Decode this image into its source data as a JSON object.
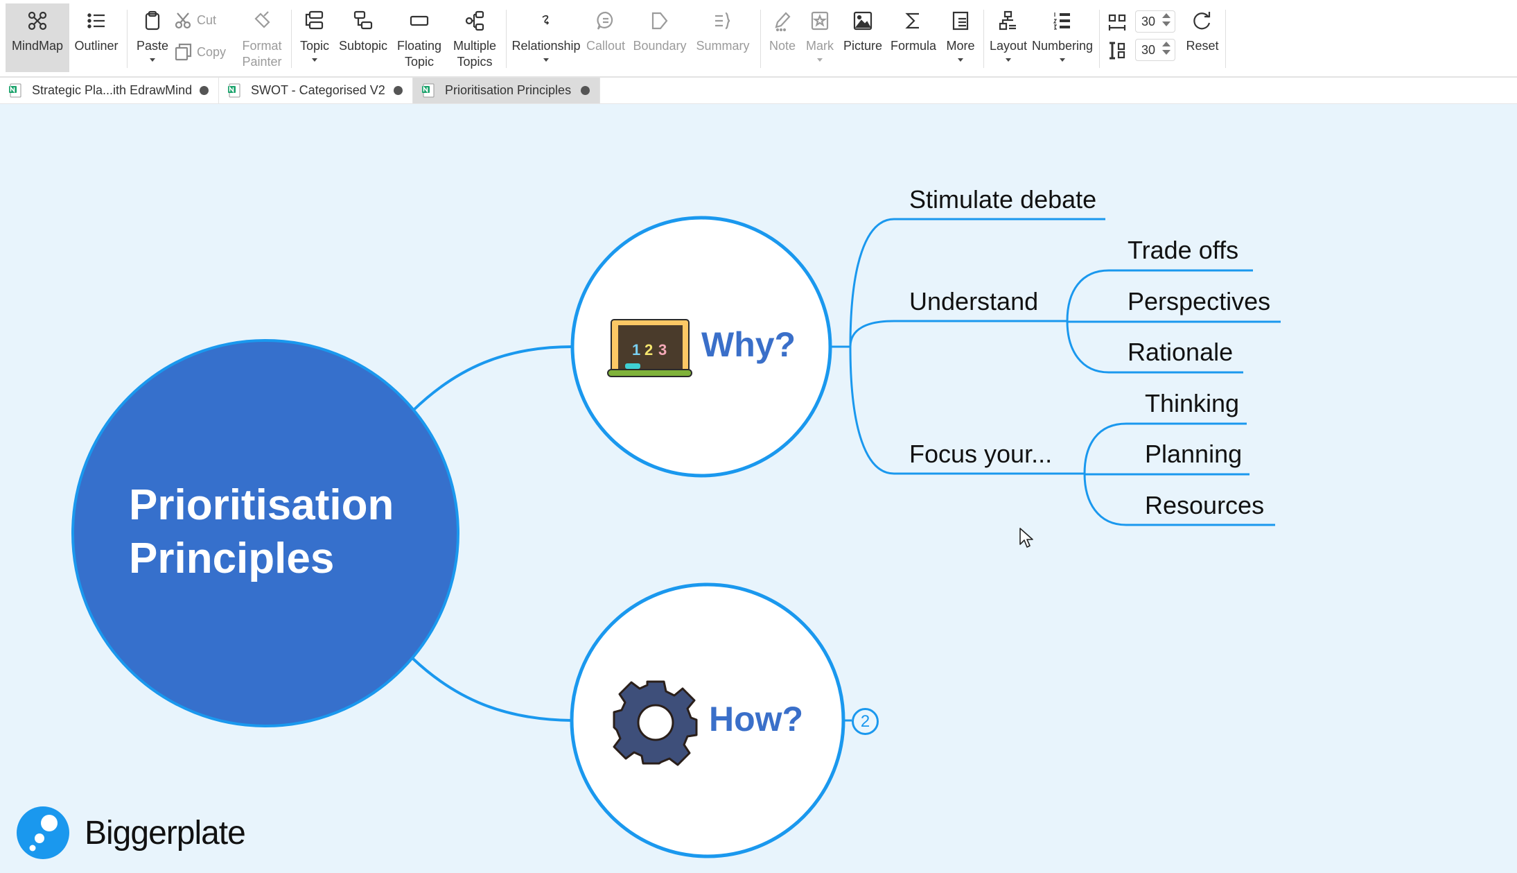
{
  "toolbar": {
    "mindmap": "MindMap",
    "outliner": "Outliner",
    "paste": "Paste",
    "cut": "Cut",
    "copy": "Copy",
    "format_painter_l1": "Format",
    "format_painter_l2": "Painter",
    "topic": "Topic",
    "subtopic": "Subtopic",
    "floating_topic_l1": "Floating",
    "floating_topic_l2": "Topic",
    "multiple_topics_l1": "Multiple",
    "multiple_topics_l2": "Topics",
    "relationship": "Relationship",
    "callout": "Callout",
    "boundary": "Boundary",
    "summary": "Summary",
    "note": "Note",
    "mark": "Mark",
    "picture": "Picture",
    "formula": "Formula",
    "more": "More",
    "layout": "Layout",
    "numbering": "Numbering",
    "horizontal_spacing": "30",
    "vertical_spacing": "30",
    "reset": "Reset"
  },
  "tabs": [
    {
      "label": "Strategic Pla...ith EdrawMind",
      "active": false
    },
    {
      "label": "SWOT - Categorised V2",
      "active": false
    },
    {
      "label": "Prioritisation Principles",
      "active": true
    }
  ],
  "mindmap": {
    "central": {
      "line1": "Prioritisation",
      "line2": "Principles"
    },
    "why": {
      "label": "Why?",
      "icon": "chalkboard-123-icon",
      "children": [
        {
          "label": "Stimulate debate",
          "children": []
        },
        {
          "label": "Understand",
          "children": [
            "Trade offs",
            "Perspectives",
            "Rationale"
          ]
        },
        {
          "label": "Focus your...",
          "children": [
            "Thinking",
            "Planning",
            "Resources"
          ]
        }
      ]
    },
    "how": {
      "label": "How?",
      "icon": "gear-icon",
      "collapsed_count": "2"
    }
  },
  "colors": {
    "canvas_bg": "#e8f4fc",
    "branch_line": "#1a98ee",
    "central_fill": "#3670cc",
    "main_topic_text": "#3a6fc9"
  },
  "watermark": {
    "brand": "Biggerplate"
  }
}
